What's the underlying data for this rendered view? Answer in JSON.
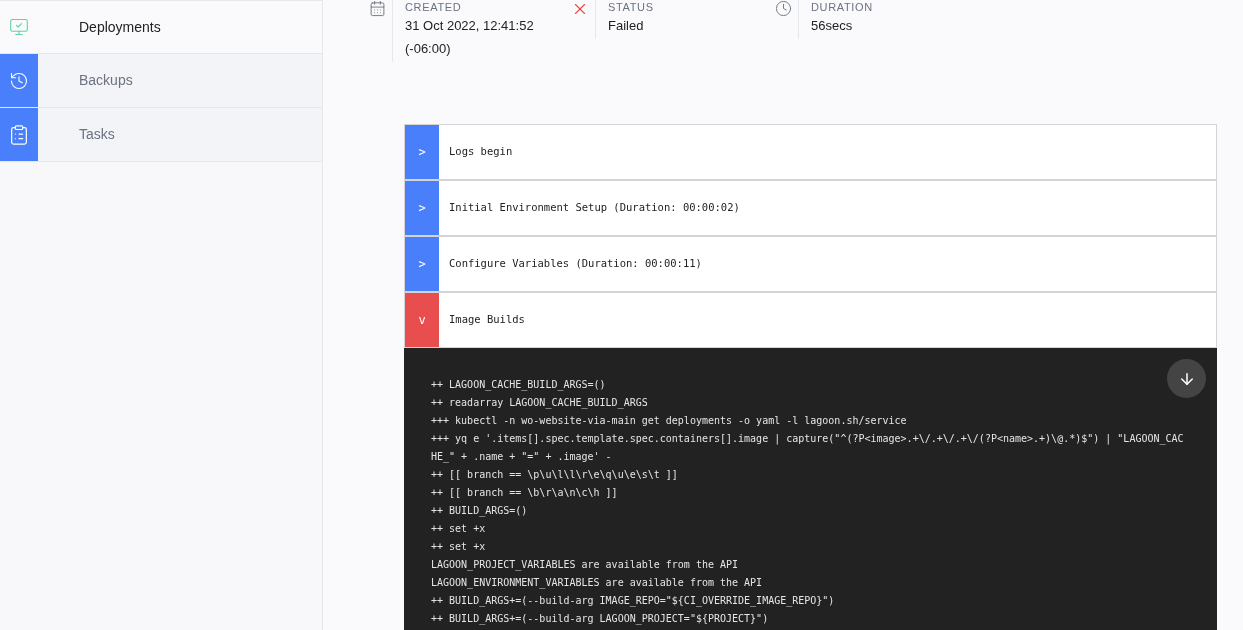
{
  "sidebar": {
    "items": [
      {
        "label": "Deployments",
        "selected": true
      },
      {
        "label": "Backups",
        "selected": false
      },
      {
        "label": "Tasks",
        "selected": false
      }
    ]
  },
  "details": [
    {
      "label": "CREATED",
      "value": [
        "31 Oct 2022, 12:41:52",
        "(-06:00)"
      ]
    },
    {
      "label": "STATUS",
      "value": [
        "Failed"
      ]
    },
    {
      "label": "DURATION",
      "value": [
        "56secs"
      ]
    }
  ],
  "log_sections": [
    {
      "toggle": ">",
      "title": "Logs begin",
      "failed": false
    },
    {
      "toggle": ">",
      "title": "Initial Environment Setup (Duration: 00:00:02)",
      "failed": false
    },
    {
      "toggle": ">",
      "title": "Configure Variables (Duration: 00:00:11)",
      "failed": false
    },
    {
      "toggle": "v",
      "title": "Image Builds",
      "failed": true,
      "lines": [
        "++ LAGOON_CACHE_BUILD_ARGS=()",
        "++ readarray LAGOON_CACHE_BUILD_ARGS",
        "+++ kubectl -n wo-website-via-main get deployments -o yaml -l lagoon.sh/service",
        "+++ yq e '.items[].spec.template.spec.containers[].image | capture(\"^(?P<image>.+\\/.+\\/.+\\/(?P<name>.+)\\@.*)$\") | \"LAGOON_CACHE_\" + .name + \"=\" + .image' -",
        "++ [[ branch == \\p\\u\\l\\l\\r\\e\\q\\u\\e\\s\\t ]]",
        "++ [[ branch == \\b\\r\\a\\n\\c\\h ]]",
        "++ BUILD_ARGS=()",
        "++ set +x",
        "++ set +x",
        "LAGOON_PROJECT_VARIABLES are available from the API",
        "LAGOON_ENVIRONMENT_VARIABLES are available from the API",
        "++ BUILD_ARGS+=(--build-arg IMAGE_REPO=\"${CI_OVERRIDE_IMAGE_REPO}\")",
        "++ BUILD_ARGS+=(--build-arg LAGOON_PROJECT=\"${PROJECT}\")"
      ]
    }
  ]
}
